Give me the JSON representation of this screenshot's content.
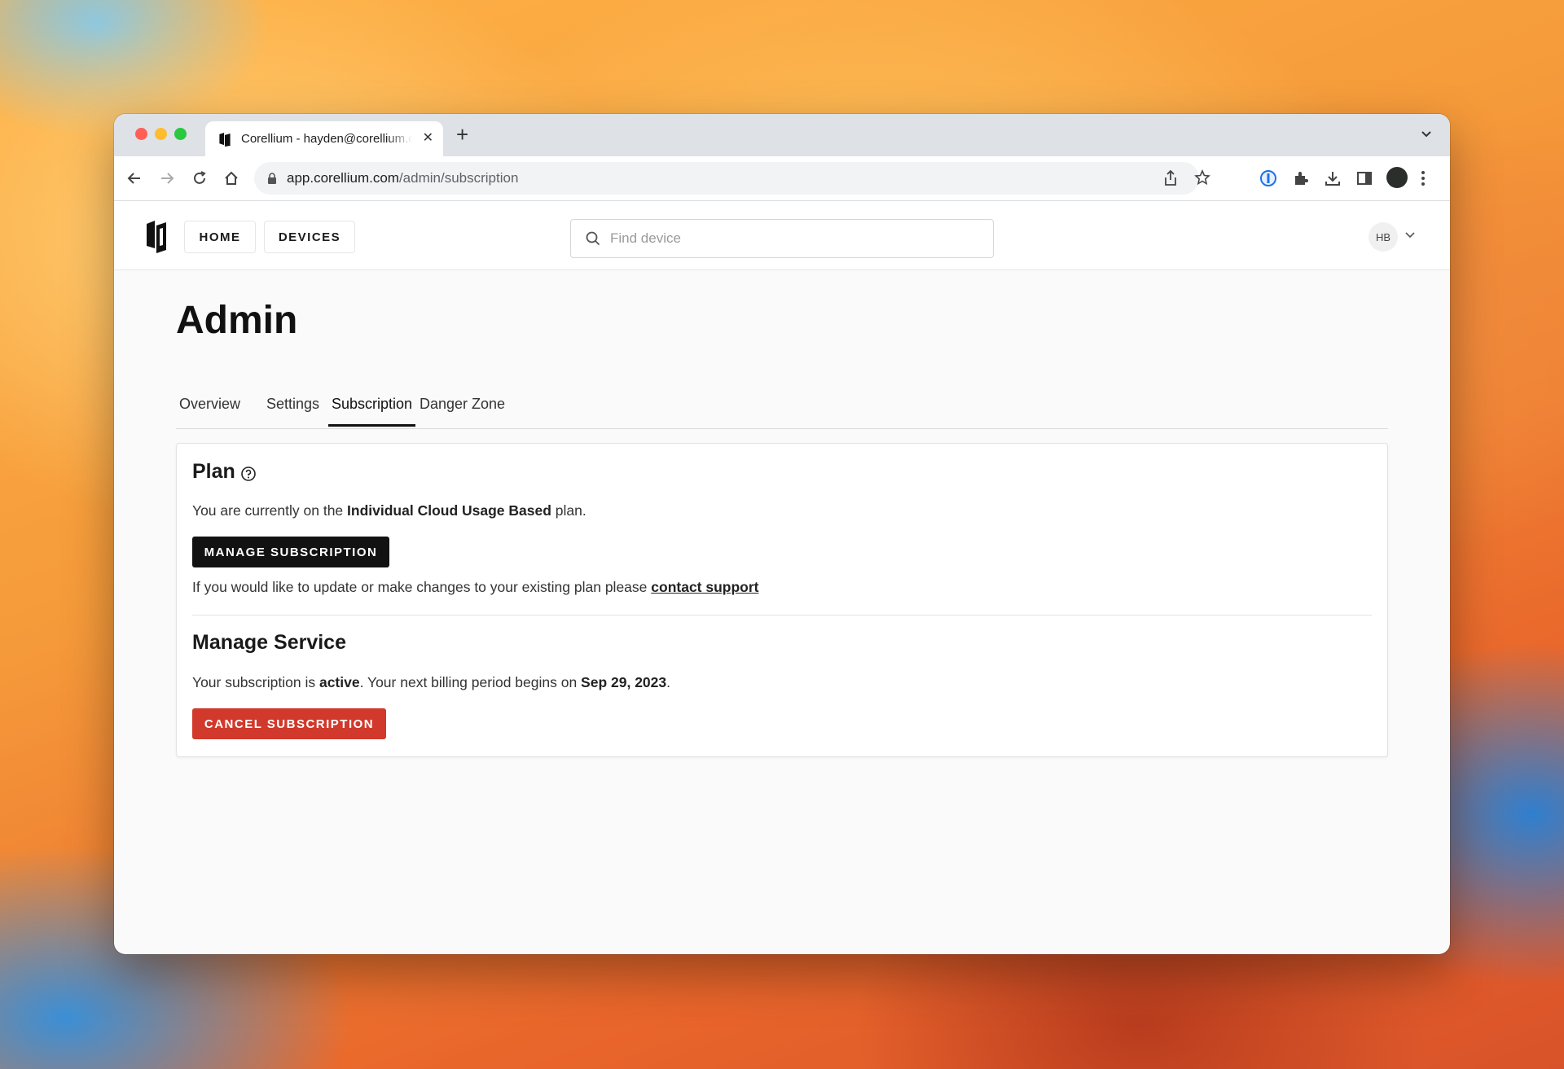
{
  "browser": {
    "tab_title": "Corellium - hayden@corellium.com",
    "url_domain": "app.corellium.com",
    "url_path": "/admin/subscription"
  },
  "header": {
    "nav_home": "HOME",
    "nav_devices": "DEVICES",
    "search_placeholder": "Find device",
    "avatar_initials": "HB"
  },
  "page": {
    "title": "Admin",
    "tabs": [
      {
        "label": "Overview"
      },
      {
        "label": "Settings"
      },
      {
        "label": "Subscription",
        "active": true
      },
      {
        "label": "Danger Zone"
      }
    ]
  },
  "plan": {
    "heading": "Plan",
    "text_prefix": "You are currently on the ",
    "plan_name": "Individual Cloud Usage Based",
    "text_suffix": " plan.",
    "manage_button": "MANAGE SUBSCRIPTION",
    "support_prefix": "If you would like to update or make changes to your existing plan please ",
    "support_link": "contact support"
  },
  "service": {
    "heading": "Manage Service",
    "status_prefix": "Your subscription is ",
    "status": "active",
    "billing_text": ". Your next billing period begins on ",
    "billing_date": "Sep 29, 2023",
    "billing_suffix": ".",
    "cancel_button": "CANCEL SUBSCRIPTION"
  },
  "colors": {
    "accent_dark": "#121212",
    "danger": "#d0392b"
  }
}
